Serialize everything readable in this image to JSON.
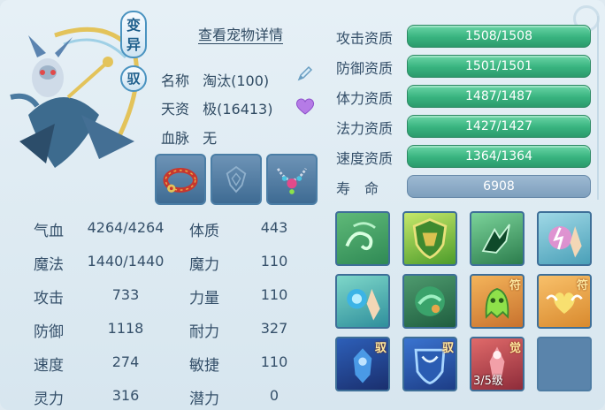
{
  "pet": {
    "mutation_badge": "变异",
    "bond_badge": "驭",
    "view_details": "查看宠物详情",
    "name_label": "名称",
    "name_value": "淘汰(100)",
    "talent_label": "天资",
    "talent_value": "极(16413)",
    "bloodline_label": "血脉",
    "bloodline_value": "无"
  },
  "stats": [
    {
      "label": "气血",
      "value": "4264/4264"
    },
    {
      "label": "魔法",
      "value": "1440/1440"
    },
    {
      "label": "攻击",
      "value": "733"
    },
    {
      "label": "防御",
      "value": "1118"
    },
    {
      "label": "速度",
      "value": "274"
    },
    {
      "label": "灵力",
      "value": "316"
    }
  ],
  "attributes": [
    {
      "label": "体质",
      "value": "443"
    },
    {
      "label": "魔力",
      "value": "110"
    },
    {
      "label": "力量",
      "value": "110"
    },
    {
      "label": "耐力",
      "value": "327"
    },
    {
      "label": "敏捷",
      "value": "110"
    },
    {
      "label": "潜力",
      "value": "0"
    }
  ],
  "aptitudes": [
    {
      "label": "攻击资质",
      "value": "1508/1508"
    },
    {
      "label": "防御资质",
      "value": "1501/1501"
    },
    {
      "label": "体力资质",
      "value": "1487/1487"
    },
    {
      "label": "法力资质",
      "value": "1427/1427"
    },
    {
      "label": "速度资质",
      "value": "1364/1364"
    }
  ],
  "lifespan": {
    "label": "寿　命",
    "value": "6908"
  },
  "skills": {
    "tag_fu": "符",
    "tag_yu": "驭",
    "tag_jue": "觉",
    "awaken_level": "3/5级"
  },
  "colors": {
    "aptitude_bar": "#3cb683",
    "lifespan_bar": "#8aa8c4",
    "text": "#35506a"
  },
  "icons": [
    "pencil-icon",
    "heart-icon",
    "red-collar-icon",
    "empty-equip-icon",
    "gem-necklace-icon"
  ]
}
